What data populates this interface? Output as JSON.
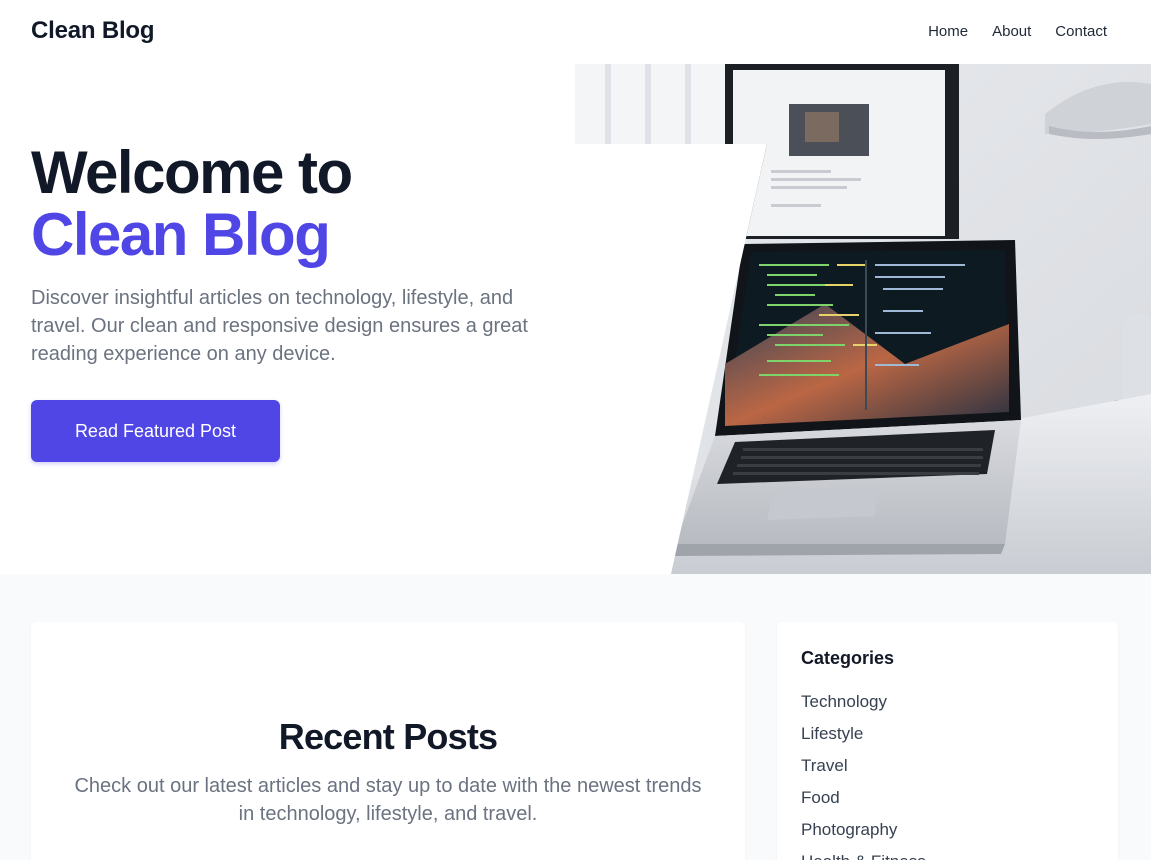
{
  "header": {
    "brand": "Clean Blog",
    "nav": [
      "Home",
      "About",
      "Contact"
    ]
  },
  "hero": {
    "title_line1": "Welcome to",
    "title_line2": "Clean Blog",
    "subtitle": "Discover insightful articles on technology, lifestyle, and travel. Our clean and responsive design ensures a great reading experience on any device.",
    "cta_label": "Read Featured Post",
    "image": "laptop-on-desk-photo"
  },
  "recent_posts": {
    "title": "Recent Posts",
    "subtitle": "Check out our latest articles and stay up to date with the newest trends in technology, lifestyle, and travel."
  },
  "sidebar": {
    "categories_title": "Categories",
    "categories": [
      "Technology",
      "Lifestyle",
      "Travel",
      "Food",
      "Photography",
      "Health & Fitness"
    ]
  },
  "colors": {
    "accent": "#4f46e5",
    "text_dark": "#111827",
    "text_muted": "#6b7280",
    "section_bg": "#f9fafb"
  }
}
